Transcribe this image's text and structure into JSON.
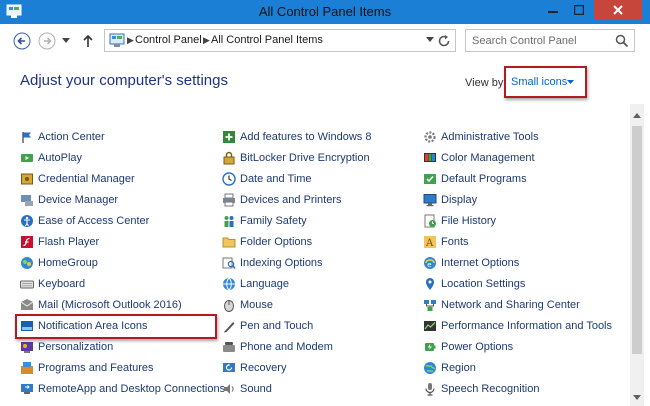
{
  "window": {
    "title": "All Control Panel Items"
  },
  "address_bar": {
    "crumbs": [
      "Control Panel",
      "All Control Panel Items"
    ]
  },
  "search": {
    "placeholder": "Search Control Panel"
  },
  "header": {
    "title": "Adjust your computer's settings",
    "view_by_label": "View by:",
    "view_by_value": "Small icons"
  },
  "columns": [
    [
      {
        "label": "Action Center",
        "icon": "flag-icon"
      },
      {
        "label": "AutoPlay",
        "icon": "autoplay-icon"
      },
      {
        "label": "Credential Manager",
        "icon": "vault-icon"
      },
      {
        "label": "Device Manager",
        "icon": "device-manager-icon"
      },
      {
        "label": "Ease of Access Center",
        "icon": "ease-of-access-icon"
      },
      {
        "label": "Flash Player",
        "icon": "flash-icon"
      },
      {
        "label": "HomeGroup",
        "icon": "homegroup-icon"
      },
      {
        "label": "Keyboard",
        "icon": "keyboard-icon"
      },
      {
        "label": "Mail (Microsoft Outlook 2016)",
        "icon": "mail-icon"
      },
      {
        "label": "Notification Area Icons",
        "icon": "notification-area-icon"
      },
      {
        "label": "Personalization",
        "icon": "personalization-icon"
      },
      {
        "label": "Programs and Features",
        "icon": "programs-icon"
      },
      {
        "label": "RemoteApp and Desktop Connections",
        "icon": "remoteapp-icon"
      }
    ],
    [
      {
        "label": "Add features to Windows 8",
        "icon": "add-features-icon"
      },
      {
        "label": "BitLocker Drive Encryption",
        "icon": "bitlocker-icon"
      },
      {
        "label": "Date and Time",
        "icon": "clock-icon"
      },
      {
        "label": "Devices and Printers",
        "icon": "printer-icon"
      },
      {
        "label": "Family Safety",
        "icon": "family-safety-icon"
      },
      {
        "label": "Folder Options",
        "icon": "folder-icon"
      },
      {
        "label": "Indexing Options",
        "icon": "indexing-icon"
      },
      {
        "label": "Language",
        "icon": "language-icon"
      },
      {
        "label": "Mouse",
        "icon": "mouse-icon"
      },
      {
        "label": "Pen and Touch",
        "icon": "pen-icon"
      },
      {
        "label": "Phone and Modem",
        "icon": "phone-icon"
      },
      {
        "label": "Recovery",
        "icon": "recovery-icon"
      },
      {
        "label": "Sound",
        "icon": "sound-icon"
      }
    ],
    [
      {
        "label": "Administrative Tools",
        "icon": "admin-tools-icon"
      },
      {
        "label": "Color Management",
        "icon": "color-management-icon"
      },
      {
        "label": "Default Programs",
        "icon": "default-programs-icon"
      },
      {
        "label": "Display",
        "icon": "display-icon"
      },
      {
        "label": "File History",
        "icon": "file-history-icon"
      },
      {
        "label": "Fonts",
        "icon": "fonts-icon"
      },
      {
        "label": "Internet Options",
        "icon": "internet-options-icon"
      },
      {
        "label": "Location Settings",
        "icon": "location-icon"
      },
      {
        "label": "Network and Sharing Center",
        "icon": "network-icon"
      },
      {
        "label": "Performance Information and Tools",
        "icon": "performance-icon"
      },
      {
        "label": "Power Options",
        "icon": "power-icon"
      },
      {
        "label": "Region",
        "icon": "region-icon"
      },
      {
        "label": "Speech Recognition",
        "icon": "microphone-icon"
      }
    ]
  ],
  "colors": {
    "title_bar": "#1c7fd6",
    "heading": "#1e3287",
    "link": "#1e3a73",
    "highlight_border": "#b01c22",
    "view_by_value": "#0066cc"
  }
}
